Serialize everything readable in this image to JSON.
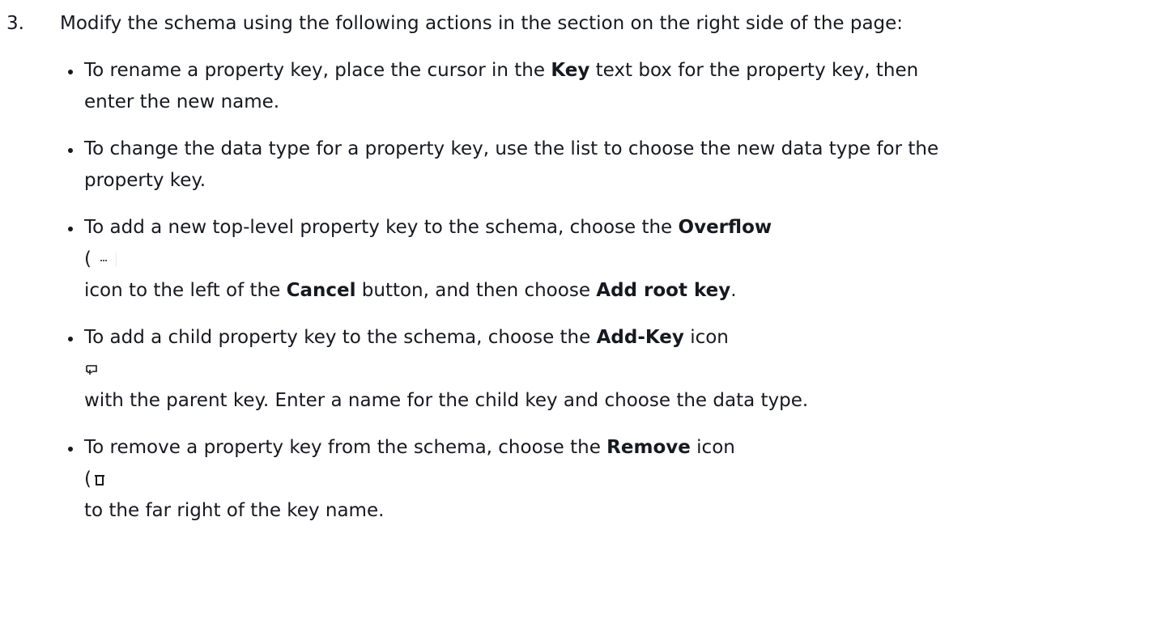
{
  "step": {
    "number": "3.",
    "text": "Modify the schema using the following actions in the section on the right side of the page:"
  },
  "actions": {
    "rename": {
      "part1": "To rename a property key, place the cursor in the ",
      "bold1": "Key",
      "part2": " text box for the property key, then",
      "line2": "enter the new name."
    },
    "change_type": {
      "line1": "To change the data type for a property key, use the list to choose the new data type for the",
      "line2": "property key."
    },
    "add_root": {
      "part1": "To add a new top-level property key to the schema, choose the ",
      "bold1": "Overflow",
      "paren_open": "(",
      "icon": "overflow-icon",
      "part2": "icon to the left of the ",
      "bold2": "Cancel",
      "part3": " button, and then choose ",
      "bold3": "Add root key",
      "part4": "."
    },
    "add_child": {
      "part1": "To add a child property key to the schema, choose the ",
      "bold1": "Add-Key",
      "part2": " icon",
      "icon": "add-key-icon",
      "line3": "with the parent key. Enter a name for the child key and choose the data type."
    },
    "remove": {
      "part1": "To remove a property key from the schema, choose the ",
      "bold1": "Remove",
      "part2": " icon",
      "paren_open": "(",
      "icon": "remove-icon",
      "line3": "to the far right of the key name."
    }
  },
  "colors": {
    "text": "#16191f",
    "background": "#ffffff"
  }
}
